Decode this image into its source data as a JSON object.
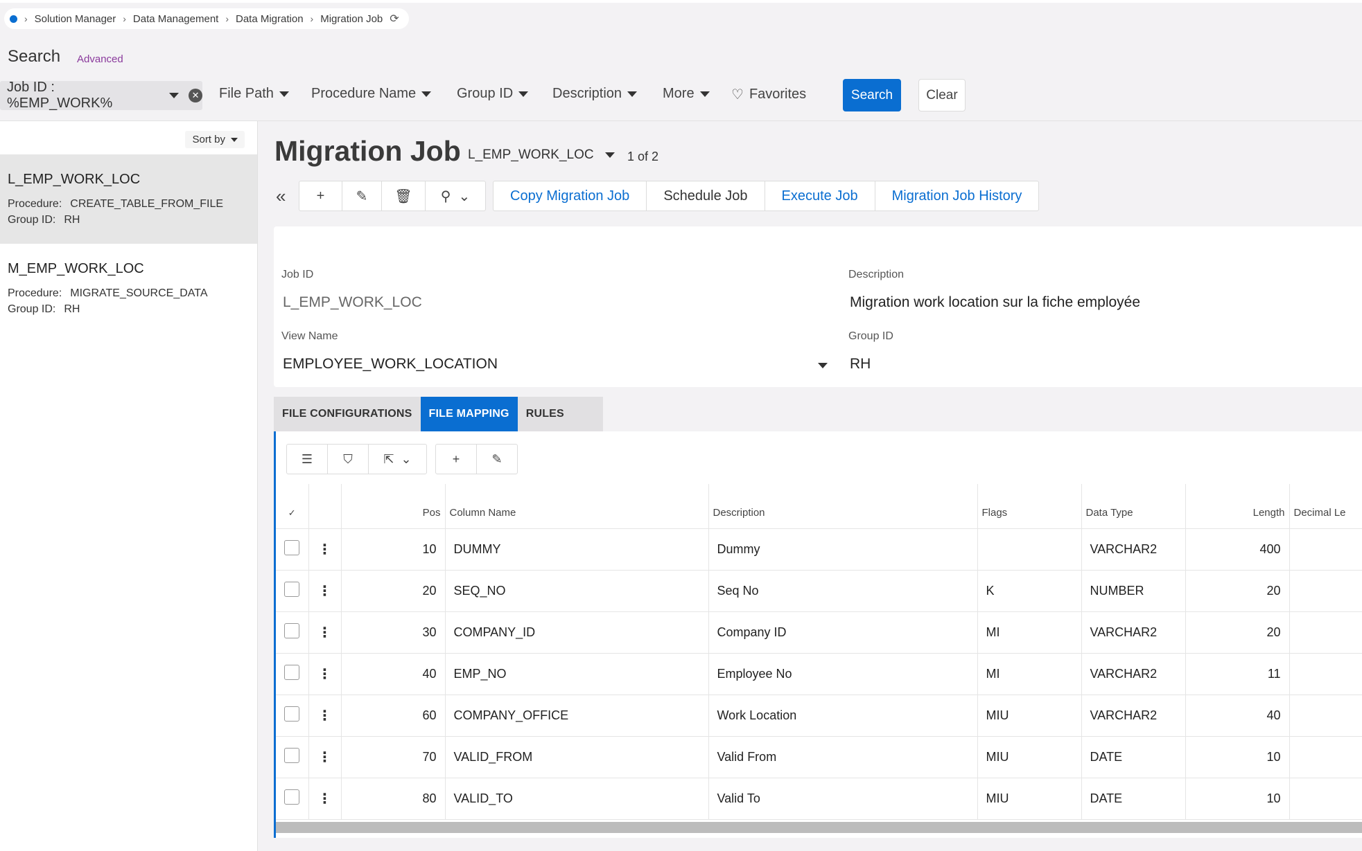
{
  "breadcrumb": [
    "Solution Manager",
    "Data Management",
    "Data Migration",
    "Migration Job"
  ],
  "search": {
    "title": "Search",
    "advanced_label": "Advanced",
    "active_filter": "Job ID : %EMP_WORK%",
    "filters": [
      "File Path",
      "Procedure Name",
      "Group ID",
      "Description",
      "More"
    ],
    "favorites_label": "Favorites",
    "search_button": "Search",
    "clear_button": "Clear"
  },
  "list": {
    "sort_label": "Sort by",
    "items": [
      {
        "title": "L_EMP_WORK_LOC",
        "procedure_label": "Procedure:",
        "procedure": "CREATE_TABLE_FROM_FILE",
        "group_label": "Group ID:",
        "group": "RH"
      },
      {
        "title": "M_EMP_WORK_LOC",
        "procedure_label": "Procedure:",
        "procedure": "MIGRATE_SOURCE_DATA",
        "group_label": "Group ID:",
        "group": "RH"
      }
    ]
  },
  "detail": {
    "title": "Migration Job",
    "record": "L_EMP_WORK_LOC",
    "count": "1 of 2",
    "actions": [
      "Copy Migration Job",
      "Schedule Job",
      "Execute Job",
      "Migration Job History"
    ]
  },
  "form": {
    "job_id_label": "Job ID",
    "job_id": "L_EMP_WORK_LOC",
    "description_label": "Description",
    "description": "Migration work location sur la fiche employée",
    "view_name_label": "View Name",
    "view_name": "EMPLOYEE_WORK_LOCATION",
    "group_id_label": "Group ID",
    "group_id": "RH"
  },
  "tabs": [
    "FILE CONFIGURATIONS",
    "FILE MAPPING",
    "RULES"
  ],
  "grid": {
    "columns": [
      "Pos",
      "Column Name",
      "Description",
      "Flags",
      "Data Type",
      "Length",
      "Decimal Le"
    ],
    "rows": [
      {
        "pos": "10",
        "column": "DUMMY",
        "description": "Dummy",
        "flags": "",
        "type": "VARCHAR2",
        "length": "400"
      },
      {
        "pos": "20",
        "column": "SEQ_NO",
        "description": "Seq No",
        "flags": "K",
        "type": "NUMBER",
        "length": "20"
      },
      {
        "pos": "30",
        "column": "COMPANY_ID",
        "description": "Company ID",
        "flags": "MI",
        "type": "VARCHAR2",
        "length": "20"
      },
      {
        "pos": "40",
        "column": "EMP_NO",
        "description": "Employee No",
        "flags": "MI",
        "type": "VARCHAR2",
        "length": "11"
      },
      {
        "pos": "60",
        "column": "COMPANY_OFFICE",
        "description": "Work Location",
        "flags": "MIU",
        "type": "VARCHAR2",
        "length": "40"
      },
      {
        "pos": "70",
        "column": "VALID_FROM",
        "description": "Valid From",
        "flags": "MIU",
        "type": "DATE",
        "length": "10"
      },
      {
        "pos": "80",
        "column": "VALID_TO",
        "description": "Valid To",
        "flags": "MIU",
        "type": "DATE",
        "length": "10"
      }
    ]
  },
  "colors": {
    "accent": "#0a6ed1",
    "advanced_link": "#8a3a9c",
    "background": "#f3f2f4"
  }
}
